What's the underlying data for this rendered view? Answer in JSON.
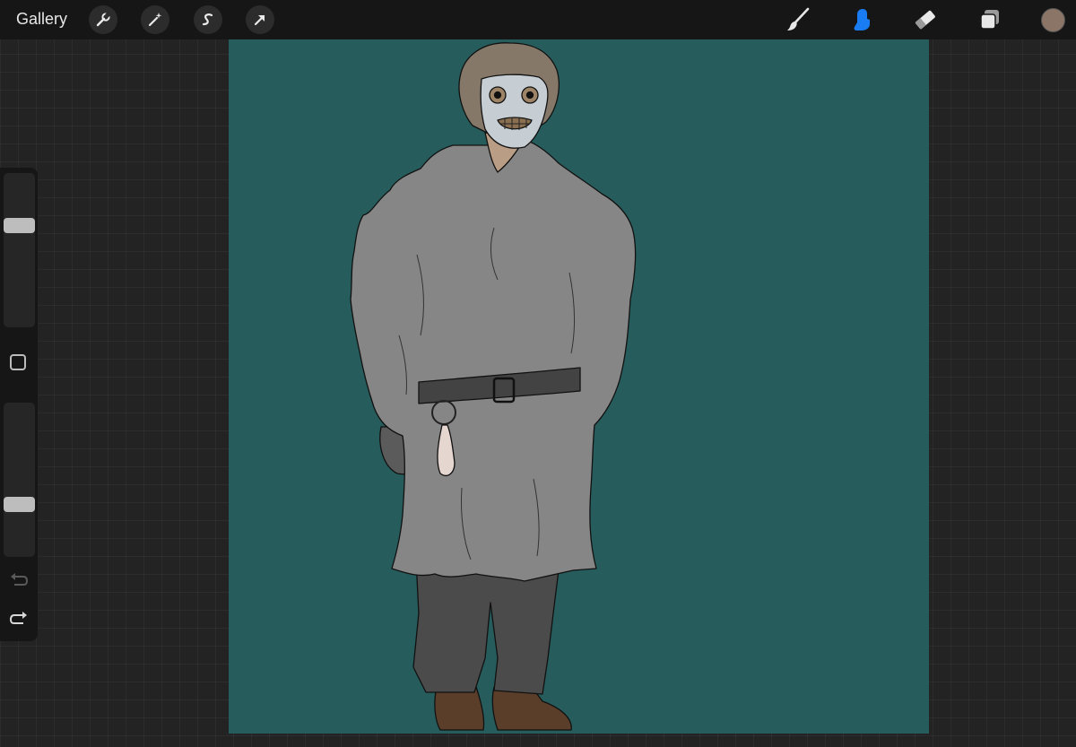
{
  "topbar": {
    "gallery_label": "Gallery",
    "left_tools": [
      "wrench-icon",
      "magic-wand-icon",
      "selection-icon",
      "transform-arrow-icon"
    ],
    "right_tools": [
      "brush-icon",
      "smudge-icon",
      "eraser-icon",
      "layers-icon"
    ],
    "active_tool": "smudge",
    "current_color": "#8b7566",
    "accent_color": "#1a7cf2"
  },
  "sidebar": {
    "brush_size_level": 0.68,
    "opacity_level": 0.32
  },
  "canvas": {
    "background_color": "#275c5c",
    "subject": "fur-coat-figure"
  }
}
